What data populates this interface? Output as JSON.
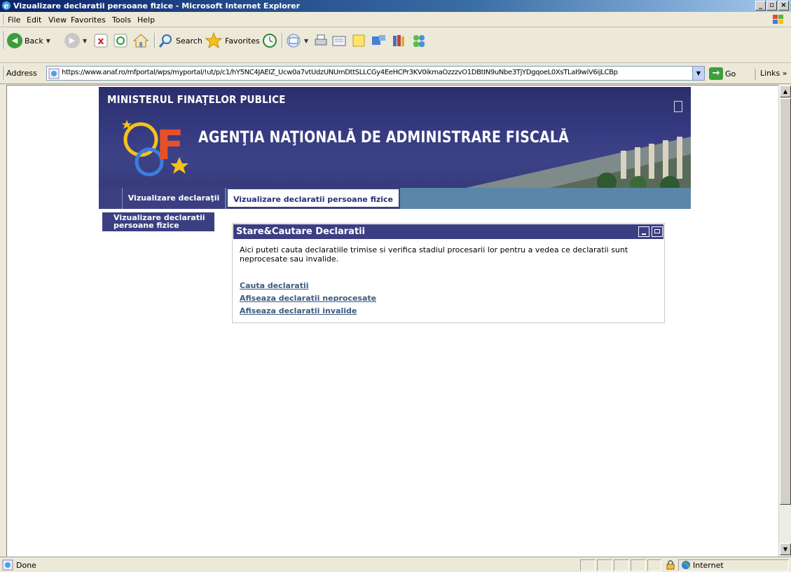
{
  "window": {
    "title": "Vizualizare declaratii persoane fizice - Microsoft Internet Explorer",
    "controls": [
      "_",
      "̱",
      "X"
    ]
  },
  "menu": {
    "items": [
      "File",
      "Edit",
      "View",
      "Favorites",
      "Tools",
      "Help"
    ]
  },
  "toolbar": {
    "back_label": "Back",
    "search_label": "Search",
    "favorites_label": "Favorites"
  },
  "address": {
    "label": "Address",
    "url": "https://www.anaf.ro/mfportal/wps/myportal/!ut/p/c1/hY5NC4JAEIZ_Ucw0a7vtUdzUNUmDttSLLCGy4EeHCPr3KV0ikmaOzzzvO1DBtIN9uNbe3TjYDgqoeL0XsTLaI9wiV6ijLCBp",
    "go_label": "Go",
    "links_label": "Links"
  },
  "banner": {
    "ministry": "MINISTERUL FINAŢELOR PUBLICE",
    "agency": "AGENŢIA NAŢIONALĂ DE ADMINISTRARE FISCALĂ"
  },
  "tabs": {
    "items": [
      {
        "label": "Vizualizare declaraţii"
      },
      {
        "label": "Vizualizare declaratii persoane fizice"
      }
    ]
  },
  "leftnav": {
    "label": "Vizualizare declaratii persoane fizice"
  },
  "portlet": {
    "title": "Stare&Cautare Declaratii",
    "description": "Aici puteti cauta declaratiile trimise si verifica stadiul procesarii lor pentru a vedea ce declaratii sunt neprocesate sau invalide.",
    "links": [
      "Cauta declaratii",
      "Afiseaza declaratii neprocesate",
      "Afiseaza declaratii invalide"
    ]
  },
  "status": {
    "text": "Done",
    "zone": "Internet"
  },
  "colors": {
    "portal_navy": "#3b3f82",
    "tab_strip_blue": "#5a86a8",
    "link": "#3d5a80"
  }
}
